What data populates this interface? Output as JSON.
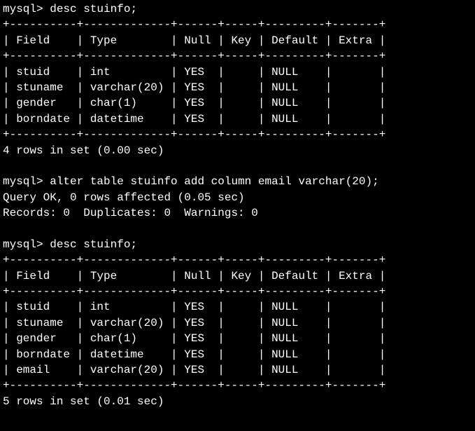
{
  "prompt": "mysql>",
  "cmd_desc": "desc stuinfo;",
  "cmd_alter": "alter table stuinfo add column email varchar(20);",
  "alter_result_line1": "Query OK, 0 rows affected (0.05 sec)",
  "alter_result_line2": "Records: 0  Duplicates: 0  Warnings: 0",
  "table_border_top": "+----------+-------------+------+-----+---------+-------+",
  "table_header": "| Field    | Type        | Null | Key | Default | Extra |",
  "table1_rows": [
    "| stuid    | int         | YES  |     | NULL    |       |",
    "| stuname  | varchar(20) | YES  |     | NULL    |       |",
    "| gender   | char(1)     | YES  |     | NULL    |       |",
    "| borndate | datetime    | YES  |     | NULL    |       |"
  ],
  "table1_footer": "4 rows in set (0.00 sec)",
  "table2_rows": [
    "| stuid    | int         | YES  |     | NULL    |       |",
    "| stuname  | varchar(20) | YES  |     | NULL    |       |",
    "| gender   | char(1)     | YES  |     | NULL    |       |",
    "| borndate | datetime    | YES  |     | NULL    |       |",
    "| email    | varchar(20) | YES  |     | NULL    |       |"
  ],
  "table2_footer": "5 rows in set (0.01 sec)",
  "chart_data": {
    "type": "table",
    "tables": [
      {
        "command": "desc stuinfo;",
        "columns": [
          "Field",
          "Type",
          "Null",
          "Key",
          "Default",
          "Extra"
        ],
        "rows": [
          [
            "stuid",
            "int",
            "YES",
            "",
            "NULL",
            ""
          ],
          [
            "stuname",
            "varchar(20)",
            "YES",
            "",
            "NULL",
            ""
          ],
          [
            "gender",
            "char(1)",
            "YES",
            "",
            "NULL",
            ""
          ],
          [
            "borndate",
            "datetime",
            "YES",
            "",
            "NULL",
            ""
          ]
        ],
        "footer": "4 rows in set (0.00 sec)"
      },
      {
        "command": "desc stuinfo;",
        "columns": [
          "Field",
          "Type",
          "Null",
          "Key",
          "Default",
          "Extra"
        ],
        "rows": [
          [
            "stuid",
            "int",
            "YES",
            "",
            "NULL",
            ""
          ],
          [
            "stuname",
            "varchar(20)",
            "YES",
            "",
            "NULL",
            ""
          ],
          [
            "gender",
            "char(1)",
            "YES",
            "",
            "NULL",
            ""
          ],
          [
            "borndate",
            "datetime",
            "YES",
            "",
            "NULL",
            ""
          ],
          [
            "email",
            "varchar(20)",
            "YES",
            "",
            "NULL",
            ""
          ]
        ],
        "footer": "5 rows in set (0.01 sec)"
      }
    ]
  }
}
